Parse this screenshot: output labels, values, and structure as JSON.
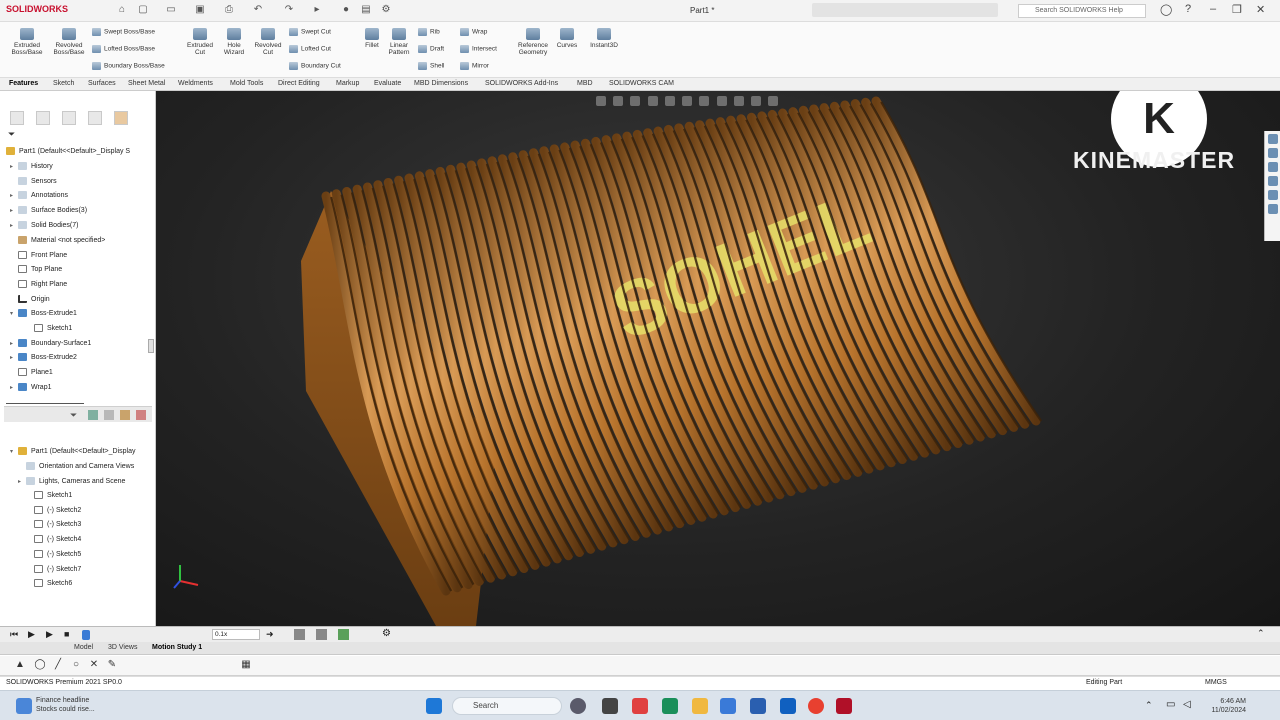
{
  "titlebar": {
    "logo": "SOLIDWORKS",
    "document": "Part1 *",
    "search_placeholder": "Search SOLIDWORKS Help"
  },
  "command_manager": {
    "big": [
      "Extruded Boss/Base",
      "Revolved Boss/Base",
      "Extruded Cut",
      "Hole Wizard",
      "Revolved Cut",
      "Fillet",
      "Linear Pattern",
      "Reference Geometry",
      "Curves",
      "Instant3D"
    ],
    "rows": [
      "Swept Boss/Base",
      "Lofted Boss/Base",
      "Boundary Boss/Base",
      "Swept Cut",
      "Lofted Cut",
      "Boundary Cut",
      "Rib",
      "Draft",
      "Shell",
      "Wrap",
      "Intersect",
      "Mirror"
    ]
  },
  "tabs": [
    "Features",
    "Sketch",
    "Surfaces",
    "Sheet Metal",
    "Weldments",
    "Mold Tools",
    "Direct Editing",
    "Markup",
    "Evaluate",
    "MBD Dimensions",
    "SOLIDWORKS Add-Ins",
    "MBD",
    "SOLIDWORKS CAM"
  ],
  "feature_tree": [
    "Part1  (Default<<Default>_Display S",
    "History",
    "Sensors",
    "Annotations",
    "Surface Bodies(3)",
    "Solid Bodies(7)",
    "Material <not specified>",
    "Front Plane",
    "Top Plane",
    "Right Plane",
    "Origin",
    "Boss-Extrude1",
    "Sketch1",
    "Boundary-Surface1",
    "Boss-Extrude2",
    "Plane1",
    "Wrap1"
  ],
  "display_tree": [
    "Part1  (Default<<Default>_Display",
    "Orientation and Camera Views",
    "Lights, Cameras and Scene",
    "Sketch1",
    "(-) Sketch2",
    "(-) Sketch3",
    "(-) Sketch4",
    "(-) Sketch5",
    "(-) Sketch7",
    "Sketch6"
  ],
  "viewport": {
    "model_text": "SOHEL",
    "watermark": "KINEMASTER",
    "watermark_letter": "K"
  },
  "motion": {
    "speed": "0.1x",
    "tabs": [
      "Model",
      "3D Views",
      "Motion Study 1"
    ]
  },
  "status": {
    "product": "SOLIDWORKS Premium 2021 SP0.0",
    "mode": "Editing Part",
    "units": "MMGS"
  },
  "taskbar": {
    "news_title": "Finance headline",
    "news_sub": "Stocks could rise...",
    "search": "Search",
    "time": "6:46 AM",
    "date": "11/02/2024"
  },
  "colors": {
    "model": "#b8742d",
    "text_highlight": "#e8e36a",
    "background_top": "#3a3a3a",
    "accent": "#c8102e"
  }
}
